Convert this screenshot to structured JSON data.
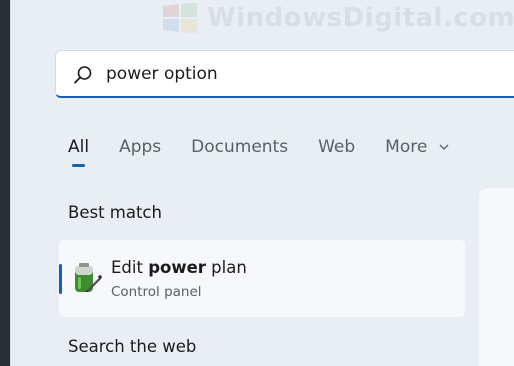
{
  "watermark": {
    "text": "WindowsDigital.com"
  },
  "search": {
    "value": "power option",
    "icon": "search-icon"
  },
  "tabs": [
    {
      "label": "All",
      "active": true
    },
    {
      "label": "Apps",
      "active": false
    },
    {
      "label": "Documents",
      "active": false
    },
    {
      "label": "Web",
      "active": false
    },
    {
      "label": "More",
      "active": false,
      "icon": "chevron-down-icon"
    }
  ],
  "best_match": {
    "heading": "Best match",
    "result": {
      "title_prefix": "Edit ",
      "title_bold": "power",
      "title_suffix": " plan",
      "subtitle": "Control panel",
      "icon": "battery-power-plan-icon"
    }
  },
  "search_web": {
    "heading": "Search the web"
  },
  "colors": {
    "accent": "#1a5fb4",
    "panel_bg": "#e9eef5",
    "card_bg": "#f6f8fb",
    "text_primary": "#1b1b1b",
    "text_secondary": "#5a5f66"
  }
}
